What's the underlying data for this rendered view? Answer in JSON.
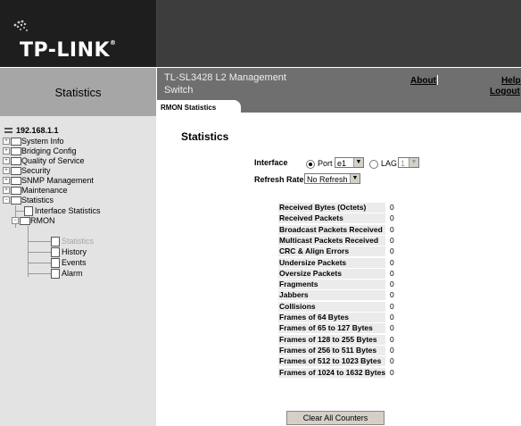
{
  "brand": {
    "logo": "TP-LINK",
    "trademark": "®"
  },
  "header": {
    "product_name": "TL-SL3428 L2 Management Switch",
    "about": "About",
    "help": "Help",
    "logout": "Logout"
  },
  "left_title": "Statistics",
  "tab": "RMON Statistics",
  "nav": {
    "ip": "192.168.1.1",
    "items": [
      "System Info",
      "Bridging Config",
      "Quality of Service",
      "Security",
      "SNMP Management",
      "Maintenance",
      "Statistics"
    ],
    "statistics_children": [
      "Interface Statistics",
      "RMON"
    ],
    "rmon_children": [
      "Statistics",
      "History",
      "Events",
      "Alarm"
    ]
  },
  "form": {
    "heading": "Statistics",
    "interface_label": "Interface",
    "port_label": "Port",
    "port_value": "e1",
    "lag_label": "LAG",
    "lag_value": "1",
    "refresh_label": "Refresh Rate",
    "refresh_value": "No Refresh"
  },
  "counters": [
    {
      "label": "Received Bytes (Octets)",
      "value": "0"
    },
    {
      "label": "Received Packets",
      "value": "0"
    },
    {
      "label": "Broadcast Packets Received",
      "value": "0"
    },
    {
      "label": "Multicast Packets Received",
      "value": "0"
    },
    {
      "label": "CRC & Align Errors",
      "value": "0"
    },
    {
      "label": "Undersize Packets",
      "value": "0"
    },
    {
      "label": "Oversize Packets",
      "value": "0"
    },
    {
      "label": "Fragments",
      "value": "0"
    },
    {
      "label": "Jabbers",
      "value": "0"
    },
    {
      "label": "Collisions",
      "value": "0"
    },
    {
      "label": "Frames of 64 Bytes",
      "value": "0"
    },
    {
      "label": "Frames of 65 to 127 Bytes",
      "value": "0"
    },
    {
      "label": "Frames of 128 to 255 Bytes",
      "value": "0"
    },
    {
      "label": "Frames of 256 to 511 Bytes",
      "value": "0"
    },
    {
      "label": "Frames of 512 to 1023 Bytes",
      "value": "0"
    },
    {
      "label": "Frames of 1024 to 1632 Bytes",
      "value": "0"
    }
  ],
  "clear_button": "Clear All Counters"
}
